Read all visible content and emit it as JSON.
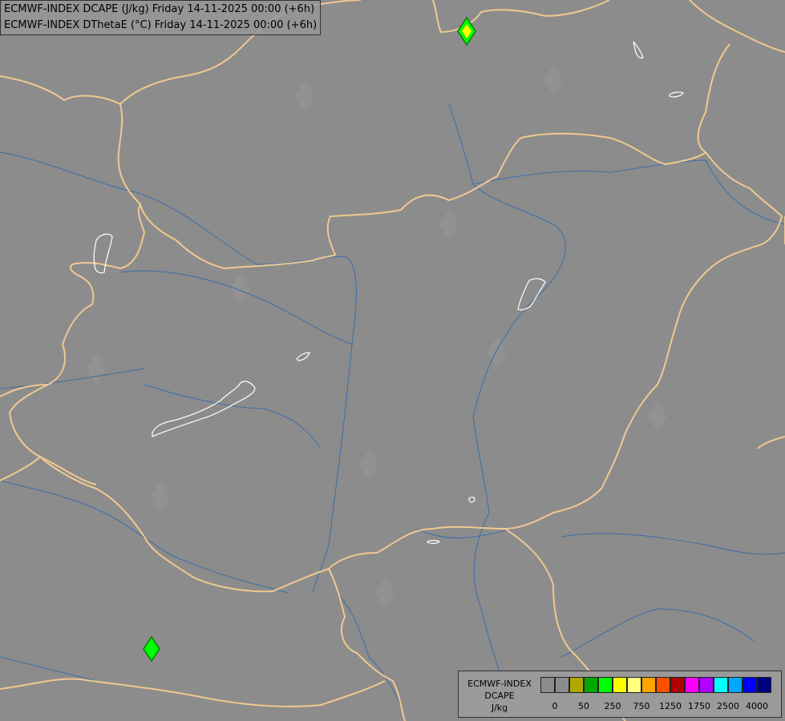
{
  "title": {
    "line1": "ECMWF-INDEX DCAPE (J/kg) Friday 14-11-2025 00:00 (+6h)",
    "line2": "ECMWF-INDEX DThetaE (°C) Friday 14-11-2025 00:00 (+6h)"
  },
  "legend": {
    "name_line1": "ECMWF-INDEX",
    "name_line2": "DCAPE",
    "unit": "J/kg",
    "colors": [
      "#8c8c8c",
      "#8c8c8c",
      "#b0a800",
      "#00a800",
      "#00ff00",
      "#ffff00",
      "#ffff80",
      "#ffa500",
      "#ff5000",
      "#b00000",
      "#ff00ff",
      "#b000ff",
      "#00ffff",
      "#00a8ff",
      "#0000ff",
      "#000080"
    ],
    "tick_labels": [
      "0",
      "50",
      "250",
      "750",
      "1250",
      "1750",
      "2500",
      "4000"
    ]
  },
  "map": {
    "background_color": "#8c8c8c",
    "border_color": "#f0c890",
    "river_color": "#3c6ea8",
    "lake_color": "#ffffff",
    "marker_colors": {
      "fill_yellow": "#ffff00",
      "fill_green": "#00ff00",
      "outline": "#008000"
    }
  }
}
